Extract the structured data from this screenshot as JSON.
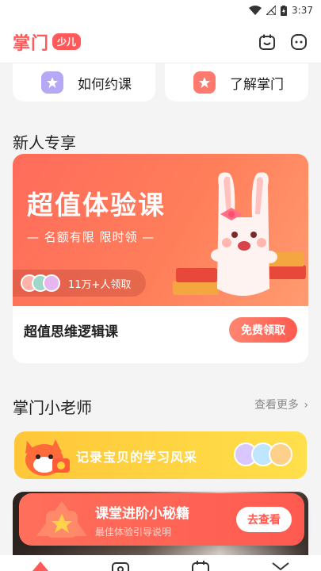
{
  "status_bar": {
    "time": "3:37",
    "icons": [
      "wifi-icon",
      "signal-off-icon",
      "battery-charging-icon"
    ]
  },
  "app": {
    "logo_text": "掌门",
    "logo_badge": "少儿",
    "brand_color": "#ff5a5a"
  },
  "header": {
    "icons": [
      "calendar-smile-icon",
      "chat-face-icon"
    ]
  },
  "quick_links": [
    {
      "label": "如何约课",
      "icon": "star-book-icon"
    },
    {
      "label": "了解掌门",
      "icon": "star-badge-icon"
    }
  ],
  "new_user": {
    "section_title": "新人专享",
    "banner_title": "超值体验课",
    "banner_subtitle": "— 名额有限 限时领 —",
    "participants": "11万+人领取",
    "course_name": "超值思维逻辑课",
    "claim_button": "免费领取"
  },
  "teachers": {
    "section_title": "掌门小老师",
    "more_link": "查看更多",
    "record_banner": "记录宝贝的学习风采"
  },
  "toast": {
    "title": "课堂进阶小秘籍",
    "subtitle": "最佳体验引导说明",
    "button": "去查看"
  },
  "tabs": [
    "home-tab-icon",
    "camera-tab-icon",
    "calendar-tab-icon",
    "mail-tab-icon"
  ]
}
